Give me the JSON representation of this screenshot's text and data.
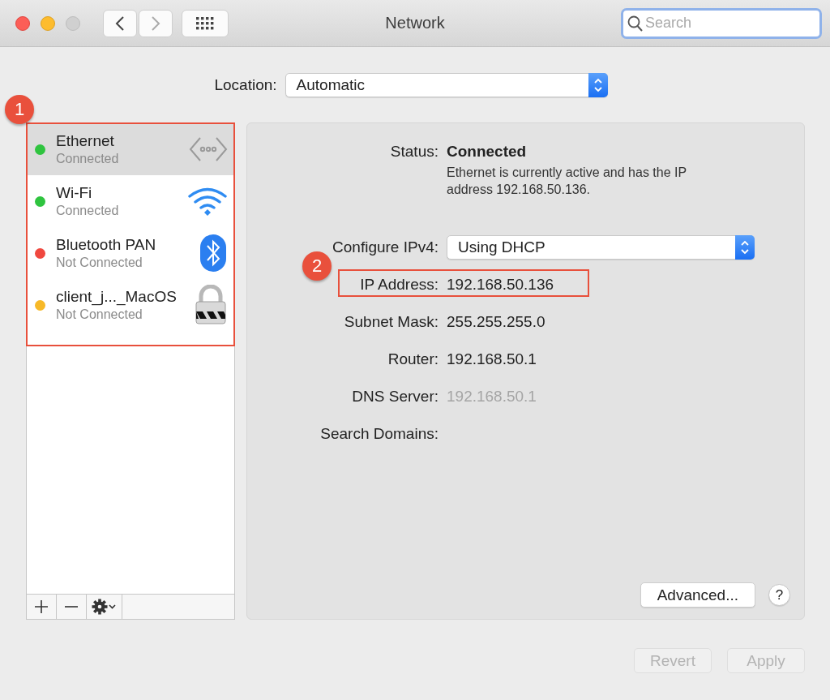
{
  "window": {
    "title": "Network",
    "search": {
      "placeholder": "Search"
    }
  },
  "location": {
    "label": "Location:",
    "value": "Automatic"
  },
  "sidebar": {
    "callout": "1",
    "highlighted": true,
    "services": [
      {
        "name": "Ethernet",
        "status": "Connected",
        "color": "#2fc43f",
        "selected": true,
        "kind": "ethernet"
      },
      {
        "name": "Wi-Fi",
        "status": "Connected",
        "color": "#2fc43f",
        "selected": false,
        "kind": "wifi"
      },
      {
        "name": "Bluetooth PAN",
        "status": "Not Connected",
        "color": "#f0483f",
        "selected": false,
        "kind": "bluetooth"
      },
      {
        "name": "client_j..._MacOS",
        "status": "Not Connected",
        "color": "#f7b928",
        "selected": false,
        "kind": "vpn"
      }
    ]
  },
  "details": {
    "status_label": "Status:",
    "status": "Connected",
    "description": "Ethernet is currently active and has the IP address 192.168.50.136.",
    "rows": [
      {
        "label": "Configure IPv4:",
        "value": "Using DHCP",
        "kind": "select"
      },
      {
        "label": "IP Address:",
        "value": "192.168.50.136",
        "kind": "text",
        "highlighted": true,
        "callout": "2"
      },
      {
        "label": "Subnet Mask:",
        "value": "255.255.255.0",
        "kind": "text"
      },
      {
        "label": "Router:",
        "value": "192.168.50.1",
        "kind": "text"
      },
      {
        "label": "DNS Server:",
        "value": "192.168.50.1",
        "kind": "text",
        "disabled": true
      },
      {
        "label": "Search Domains:",
        "kind": "text"
      }
    ],
    "advanced": "Advanced...",
    "help": "?"
  },
  "footer": [
    {
      "label": "Revert",
      "disabled": true
    },
    {
      "label": "Apply",
      "disabled": true
    }
  ]
}
